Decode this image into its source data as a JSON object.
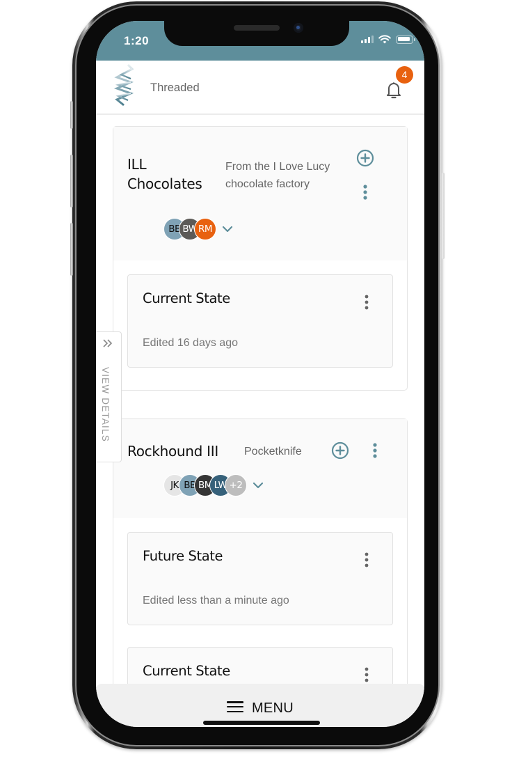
{
  "status_bar": {
    "time": "1:20",
    "signal_bars_active": 3,
    "signal_bars_total": 4,
    "icons": [
      "signal-icon",
      "wifi-icon",
      "battery-icon"
    ]
  },
  "header": {
    "logo_icon": "threaded-logo-icon",
    "app_title": "Threaded",
    "notifications_icon": "bell-icon",
    "notification_count": "4",
    "badge_color": "#e8610f",
    "brand_color": "#5e8e9b"
  },
  "view_details": {
    "label": "VIEW DETAILS",
    "icon": "double-chevron-right-icon"
  },
  "projects": [
    {
      "name_line1": "ILL",
      "name_line2": "Chocolates",
      "description_line1": "From the I Love Lucy",
      "description_line2": "chocolate factory",
      "members": [
        {
          "initials": "BB",
          "color": "#7fa2b5",
          "text_color": "#111111"
        },
        {
          "initials": "BW",
          "color": "#5c5a57",
          "text_color": "#ffffff"
        },
        {
          "initials": "RM",
          "color": "#e8610f",
          "text_color": "#ffffff"
        }
      ],
      "documents": [
        {
          "title": "Current State",
          "edited": "Edited 16 days ago"
        }
      ]
    },
    {
      "name": "Rockhound III",
      "description": "Pocketknife",
      "members": [
        {
          "initials": "JK",
          "color": "#e5e5e5",
          "text_color": "#111111"
        },
        {
          "initials": "BB",
          "color": "#7fa2b5",
          "text_color": "#111111"
        },
        {
          "initials": "BM",
          "color": "#353535",
          "text_color": "#ffffff"
        },
        {
          "initials": "LW",
          "color": "#36617a",
          "text_color": "#ffffff"
        },
        {
          "initials": "+2",
          "color": "#bdbdbd",
          "text_color": "#ffffff"
        }
      ],
      "documents": [
        {
          "title": "Future State",
          "edited": "Edited less than a minute ago"
        },
        {
          "title": "Current State",
          "edited": ""
        }
      ]
    }
  ],
  "menu": {
    "label": "MENU",
    "icon": "hamburger-icon"
  }
}
